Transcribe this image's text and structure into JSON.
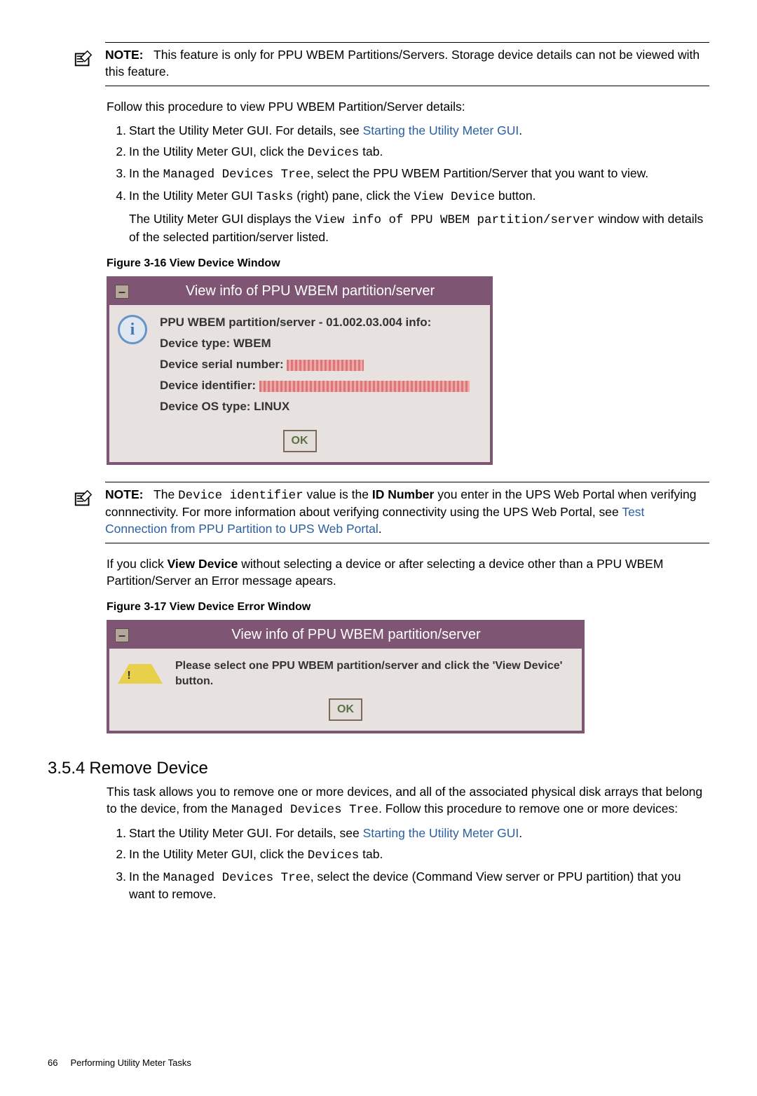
{
  "note1": {
    "label": "NOTE:",
    "text1": "This feature is only for PPU WBEM Partitions/Servers. Storage device details can not be viewed with this feature."
  },
  "intro1": "Follow this procedure to view PPU WBEM Partition/Server details:",
  "steps1": {
    "s1a": "Start the Utility Meter GUI. For details, see ",
    "s1link": "Starting the Utility Meter GUI",
    "s1b": ".",
    "s2a": "In the Utility Meter GUI, click the ",
    "s2mono": "Devices",
    "s2b": " tab.",
    "s3a": "In the ",
    "s3mono": "Managed Devices Tree",
    "s3b": ", select the PPU WBEM Partition/Server that you want to view.",
    "s4a": "In the Utility Meter GUI ",
    "s4mono1": "Tasks",
    "s4b": " (right) pane, click the ",
    "s4mono2": "View Device",
    "s4c": " button.",
    "s4sub_a": "The Utility Meter GUI displays the ",
    "s4sub_mono": "View info of PPU WBEM partition/server",
    "s4sub_b": " window with details of the selected partition/server listed."
  },
  "fig1_caption": "Figure 3-16 View Device Window",
  "dialog1": {
    "title": "View info of PPU WBEM partition/server",
    "line1": "PPU WBEM partition/server - 01.002.03.004  info:",
    "line2": "Device type: WBEM",
    "line3": "Device serial number: ",
    "line4": "Device identifier: ",
    "line5": "Device OS type: LINUX",
    "ok": "OK"
  },
  "note2": {
    "label": "NOTE:",
    "pre": "The ",
    "mono": "Device identifier",
    "mid1": " value is the ",
    "bold": "ID Number",
    "mid2": " you enter in the UPS Web Portal when verifying connnectivity. For more information about verifying connectivity using the UPS Web Portal, see ",
    "link": "Test Connection from PPU Partition to UPS Web Portal",
    "post": "."
  },
  "after_note2_a": "If you click ",
  "after_note2_bold": "View Device",
  "after_note2_b": " without selecting a device or after selecting a device other than a PPU WBEM Partition/Server an Error message apears.",
  "fig2_caption": "Figure 3-17 View Device Error Window",
  "dialog2": {
    "title": "View info of PPU WBEM partition/server",
    "msg": "Please select one PPU WBEM partition/server and click the 'View Device' button.",
    "ok": "OK"
  },
  "section": {
    "num": "3.5.4",
    "title": "Remove Device"
  },
  "remove_intro_a": "This task allows you to remove one or more devices, and all of the associated physical disk arrays that belong to the device, from the ",
  "remove_intro_mono": "Managed Devices Tree",
  "remove_intro_b": ". Follow this procedure to remove one or more devices:",
  "steps2": {
    "s1a": "Start the Utility Meter GUI. For details, see ",
    "s1link": "Starting the Utility Meter GUI",
    "s1b": ".",
    "s2a": "In the Utility Meter GUI, click the ",
    "s2mono": "Devices",
    "s2b": " tab.",
    "s3a": "In the ",
    "s3mono": "Managed Devices Tree",
    "s3b": ", select the device (Command View server or PPU partition) that you want to remove."
  },
  "footer": {
    "page": "66",
    "label": "Performing Utility Meter Tasks"
  }
}
